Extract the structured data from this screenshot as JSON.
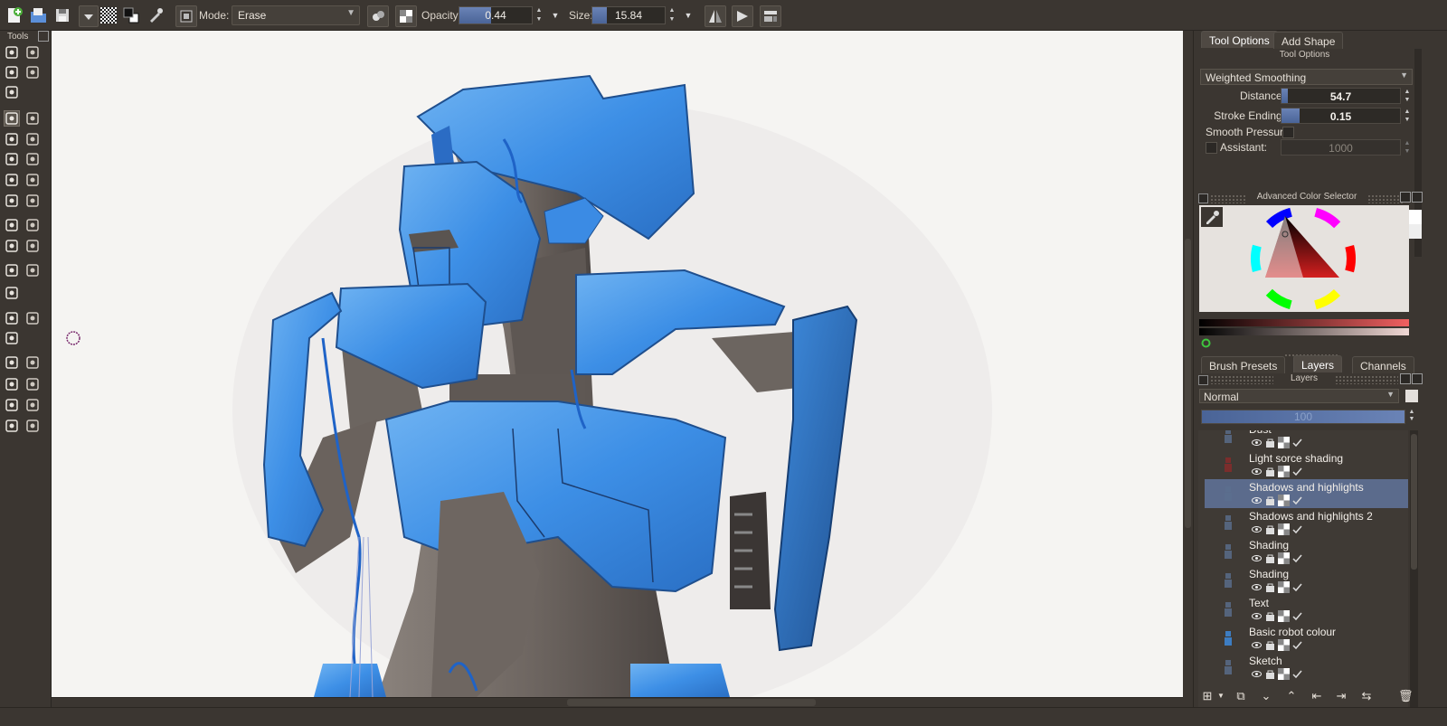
{
  "toolbar": {
    "mode_label": "Mode:",
    "mode_value": "Erase",
    "opacity_label": "Opacity:",
    "opacity_value": "0.44",
    "opacity_fraction": 0.44,
    "size_label": "Size:",
    "size_value": "15.84",
    "size_fraction": 0.2
  },
  "toolbox": {
    "title": "Tools"
  },
  "tool_options": {
    "tabs": [
      "Tool Options",
      "Add Shape"
    ],
    "caption": "Tool Options",
    "smoothing_mode": "Weighted Smoothing",
    "distance_label": "Distance:",
    "distance_value": "54.7",
    "distance_fraction": 0.05,
    "stroke_ending_label": "Stroke Ending:",
    "stroke_ending_value": "0.15",
    "stroke_ending_fraction": 0.15,
    "smooth_pressure_label": "Smooth Pressure",
    "assistant_label": "Assistant:",
    "assistant_value": "1000"
  },
  "color_selector": {
    "caption": "Advanced Color Selector"
  },
  "layers_panel": {
    "tabs": [
      "Brush Presets",
      "Layers",
      "Channels"
    ],
    "caption": "Layers",
    "blend_mode": "Normal",
    "opacity_value": "100",
    "layers": [
      {
        "name": "Dust",
        "selected": false
      },
      {
        "name": "Light sorce shading",
        "selected": false
      },
      {
        "name": "Shadows and highlights",
        "selected": true
      },
      {
        "name": "Shadows and highlights 2",
        "selected": false
      },
      {
        "name": "Shading",
        "selected": false
      },
      {
        "name": "Shading",
        "selected": false
      },
      {
        "name": "Text",
        "selected": false
      },
      {
        "name": "Basic robot colour",
        "selected": false
      },
      {
        "name": "Sketch",
        "selected": false
      }
    ]
  },
  "colors": {
    "ui_background": "#3b3631",
    "slider_fill": "#5b75aa",
    "selection": "#5b6b8c",
    "robot_blue": "#3d8fe6",
    "robot_grey": "#6f6762"
  }
}
